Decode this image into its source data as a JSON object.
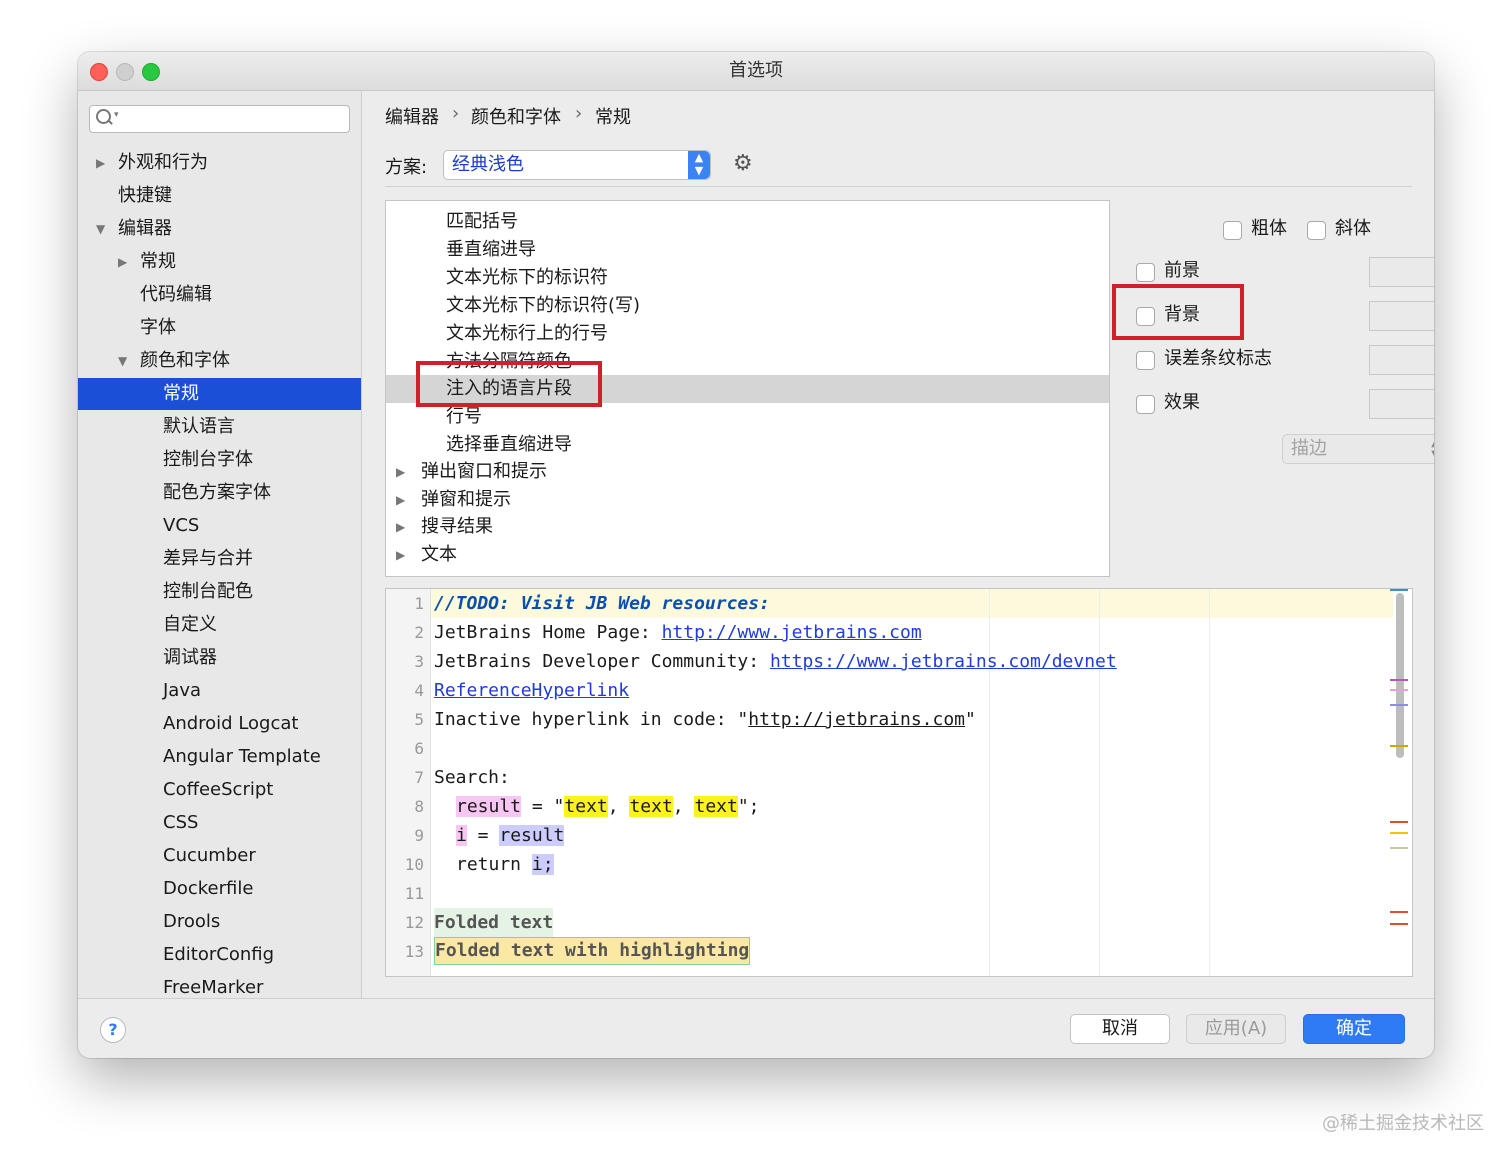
{
  "window": {
    "title": "首选项"
  },
  "sidebar": {
    "search_placeholder": "",
    "items": [
      {
        "label": "外观和行为"
      },
      {
        "label": "快捷键"
      },
      {
        "label": "编辑器"
      },
      {
        "label": "常规"
      },
      {
        "label": "代码编辑"
      },
      {
        "label": "字体"
      },
      {
        "label": "颜色和字体"
      },
      {
        "label": "常规"
      },
      {
        "label": "默认语言"
      },
      {
        "label": "控制台字体"
      },
      {
        "label": "配色方案字体"
      },
      {
        "label": "VCS"
      },
      {
        "label": "差异与合并"
      },
      {
        "label": "控制台配色"
      },
      {
        "label": "自定义"
      },
      {
        "label": "调试器"
      },
      {
        "label": "Java"
      },
      {
        "label": "Android Logcat"
      },
      {
        "label": "Angular Template"
      },
      {
        "label": "CoffeeScript"
      },
      {
        "label": "CSS"
      },
      {
        "label": "Cucumber"
      },
      {
        "label": "Dockerfile"
      },
      {
        "label": "Drools"
      },
      {
        "label": "EditorConfig"
      },
      {
        "label": "FreeMarker"
      }
    ]
  },
  "breadcrumb": {
    "items": [
      "编辑器",
      "颜色和字体",
      "常规"
    ],
    "separator": "›"
  },
  "scheme": {
    "label": "方案:",
    "value": "经典浅色"
  },
  "element_list": {
    "items": [
      {
        "label": "匹配括号"
      },
      {
        "label": "垂直缩进导"
      },
      {
        "label": "文本光标下的标识符"
      },
      {
        "label": "文本光标下的标识符(写)"
      },
      {
        "label": "文本光标行上的行号"
      },
      {
        "label": "方法分隔符颜色"
      },
      {
        "label": "注入的语言片段"
      },
      {
        "label": "行号"
      },
      {
        "label": "选择垂直缩进导"
      },
      {
        "label": "弹出窗口和提示"
      },
      {
        "label": "弹窗和提示"
      },
      {
        "label": "搜寻结果"
      },
      {
        "label": "文本"
      }
    ]
  },
  "attributes": {
    "bold": "粗体",
    "italic": "斜体",
    "foreground": "前景",
    "background": "背景",
    "error_stripe": "误差条纹标志",
    "effects": "效果",
    "effect_type": "描边"
  },
  "preview": {
    "line_numbers": [
      "1",
      "2",
      "3",
      "4",
      "5",
      "6",
      "7",
      "8",
      "9",
      "10",
      "11",
      "12",
      "13"
    ],
    "l1": "//TODO: Visit JB Web resources:",
    "l2_text": "JetBrains Home Page: ",
    "l2_link": "http://www.jetbrains.com",
    "l3_text": "JetBrains Developer Community: ",
    "l3_link": "https://www.jetbrains.com/devnet",
    "l4_link": "ReferenceHyperlink",
    "l5_text": "Inactive hyperlink in code: \"",
    "l5_link": "http://jetbrains.com",
    "l5_end": "\"",
    "l7": "Search:",
    "l8_var": "result",
    "l8_eq": " = \"",
    "l8_t1": "text",
    "l8_sep1": ", ",
    "l8_t2": "text",
    "l8_sep2": ", ",
    "l8_t3": "text",
    "l8_end": "\";",
    "l9_i": "i",
    "l9_eq": " = ",
    "l9_var": "result",
    "l10_ret": "return ",
    "l10_i": "i;",
    "l12": "Folded text",
    "l13": "Folded text with highlighting"
  },
  "footer": {
    "help": "?",
    "cancel": "取消",
    "apply": "应用(A)",
    "ok": "确定"
  },
  "watermark": "@稀土掘金技术社区",
  "colors": {
    "selection": "#1a4fd6",
    "annotation_red": "#d0202a",
    "ok_button": "#2f7bf5"
  }
}
